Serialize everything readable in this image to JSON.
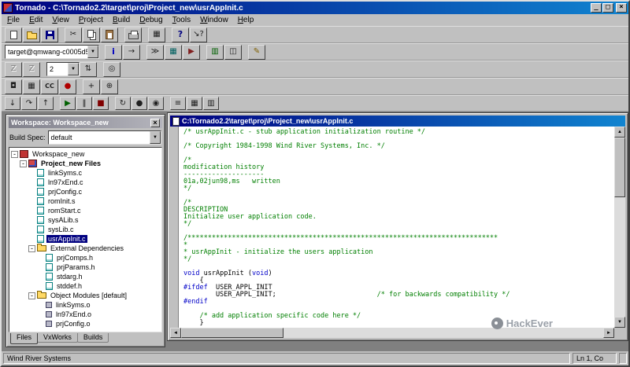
{
  "window": {
    "title": "Tornado - C:\\Tornado2.2\\target\\proj\\Project_new\\usrAppInit.c",
    "controls": {
      "minimize": "_",
      "maximize": "□",
      "close": "×"
    }
  },
  "menu": {
    "items": [
      "File",
      "Edit",
      "View",
      "Project",
      "Build",
      "Debug",
      "Tools",
      "Window",
      "Help"
    ]
  },
  "icons": {
    "chevron_down": "▼",
    "scroll_up": "▲",
    "scroll_down": "▼",
    "scroll_left": "◄",
    "scroll_right": "►",
    "collapse": "-"
  },
  "toolbars": [
    {
      "items": [
        {
          "name": "new-file-button",
          "icon": "new-document-icon",
          "shape": "s-doc"
        },
        {
          "name": "open-file-button",
          "icon": "open-folder-icon",
          "shape": "s-folder"
        },
        {
          "name": "save-button",
          "icon": "save-icon",
          "shape": "s-save"
        },
        {
          "type": "sep"
        },
        {
          "name": "cut-button",
          "icon": "scissors-icon",
          "glyph": "✂"
        },
        {
          "name": "copy-button",
          "icon": "copy-icon",
          "shape": "s-copy"
        },
        {
          "name": "paste-button",
          "icon": "paste-icon",
          "shape": "s-paste"
        },
        {
          "type": "sep"
        },
        {
          "name": "print-button",
          "icon": "printer-icon",
          "shape": "s-print"
        },
        {
          "type": "sep"
        },
        {
          "name": "workspace-toggle-button",
          "icon": "workspace-panel-icon",
          "glyph": "▦"
        },
        {
          "type": "sep"
        },
        {
          "name": "help-button",
          "icon": "help-icon",
          "glyph": "?",
          "color": "#000080"
        },
        {
          "name": "context-help-button",
          "icon": "context-help-icon",
          "glyph": "↘?"
        }
      ]
    },
    {
      "items": [
        {
          "type": "combo",
          "name": "target-selector",
          "value": "target@qmwang-c0005d5"
        },
        {
          "type": "sep"
        },
        {
          "name": "target-info-button",
          "icon": "info-icon",
          "glyph": "i",
          "color": "#0000c0"
        },
        {
          "name": "attach-target-button",
          "icon": "attach-target-icon",
          "glyph": "→"
        },
        {
          "type": "sep"
        },
        {
          "name": "launch-shell-button",
          "icon": "shell-icon",
          "glyph": "≫"
        },
        {
          "name": "browser-button",
          "icon": "browser-icon",
          "glyph": "▦",
          "color": "#006060"
        },
        {
          "name": "debugger-button",
          "icon": "debugger-icon",
          "glyph": "▶",
          "color": "#802020"
        },
        {
          "type": "sep"
        },
        {
          "name": "windview-button",
          "icon": "windview-icon",
          "glyph": "▥",
          "color": "#006000"
        },
        {
          "name": "registry-button",
          "icon": "registry-icon",
          "glyph": "◫"
        },
        {
          "type": "sep"
        },
        {
          "name": "editor-button",
          "icon": "pencil-icon",
          "glyph": "✎",
          "color": "#806000"
        }
      ]
    },
    {
      "items": [
        {
          "name": "undo-button",
          "icon": "undo-icon",
          "glyph": "Z",
          "disabled": true
        },
        {
          "name": "redo-button",
          "icon": "redo-icon",
          "glyph": "Z",
          "disabled": true
        },
        {
          "type": "sep"
        },
        {
          "type": "combo",
          "name": "history-selector",
          "value": "2"
        },
        {
          "name": "navigate-stack-button",
          "icon": "up-down-arrows-icon",
          "glyph": "⇅"
        },
        {
          "type": "sep"
        },
        {
          "name": "find-symbol-button",
          "icon": "search-icon",
          "glyph": "◎"
        }
      ]
    },
    {
      "items": [
        {
          "name": "target-lock-button",
          "icon": "lock-icon",
          "glyph": "◘"
        },
        {
          "name": "memory-view-button",
          "icon": "memory-grid-icon",
          "glyph": "▦"
        },
        {
          "name": "code-coverage-button",
          "icon": "code-coverage-icon",
          "glyph": "CC"
        },
        {
          "name": "record-button",
          "icon": "record-icon",
          "glyph": "●",
          "color": "#b00000"
        },
        {
          "type": "sep"
        },
        {
          "name": "add-watch-button",
          "icon": "plus-icon",
          "glyph": "+"
        },
        {
          "name": "configure-button",
          "icon": "configure-icon",
          "glyph": "⊕"
        }
      ]
    },
    {
      "items": [
        {
          "name": "step-into-button",
          "icon": "step-into-icon",
          "glyph": "↓"
        },
        {
          "name": "step-over-button",
          "icon": "step-over-icon",
          "glyph": "↷"
        },
        {
          "name": "step-out-button",
          "icon": "step-out-icon",
          "glyph": "↑"
        },
        {
          "type": "sep"
        },
        {
          "name": "run-button",
          "icon": "run-icon",
          "glyph": "▶",
          "color": "#006000"
        },
        {
          "name": "pause-button",
          "icon": "pause-icon",
          "glyph": "‖"
        },
        {
          "name": "stop-button",
          "icon": "stop-icon",
          "glyph": "■",
          "color": "#800000"
        },
        {
          "type": "sep"
        },
        {
          "name": "restart-button",
          "icon": "restart-icon",
          "glyph": "↻"
        },
        {
          "name": "breakpoint-button",
          "icon": "breakpoint-icon",
          "glyph": "●"
        },
        {
          "name": "watch-button",
          "icon": "watch-icon",
          "glyph": "◉"
        },
        {
          "type": "sep"
        },
        {
          "name": "stack-button",
          "icon": "stack-icon",
          "glyph": "≡"
        },
        {
          "name": "memory-button",
          "icon": "memory-icon",
          "glyph": "▦"
        },
        {
          "name": "registers-button",
          "icon": "registers-icon",
          "glyph": "▥"
        }
      ]
    }
  ],
  "workspace": {
    "title": "Workspace: Workspace_new",
    "close_label": "×",
    "build_spec_label": "Build Spec:",
    "build_spec_value": "default",
    "tabs": [
      "Files",
      "VxWorks",
      "Builds"
    ],
    "tree": [
      {
        "label": "Workspace_new",
        "level": 0,
        "icon": "workspace",
        "expander": "minus"
      },
      {
        "label": "Project_new Files",
        "level": 1,
        "icon": "project",
        "expander": "minus",
        "bold": true
      },
      {
        "label": "linkSyms.c",
        "level": 2,
        "icon": "source-file"
      },
      {
        "label": "ln97xEnd.c",
        "level": 2,
        "icon": "source-file"
      },
      {
        "label": "prjConfig.c",
        "level": 2,
        "icon": "source-file"
      },
      {
        "label": "romInit.s",
        "level": 2,
        "icon": "source-file"
      },
      {
        "label": "romStart.c",
        "level": 2,
        "icon": "source-file"
      },
      {
        "label": "sysALib.s",
        "level": 2,
        "icon": "source-file"
      },
      {
        "label": "sysLib.c",
        "level": 2,
        "icon": "source-file"
      },
      {
        "label": "usrAppInit.c",
        "level": 2,
        "icon": "source-file",
        "selected": true
      },
      {
        "label": "External Dependencies",
        "level": 2,
        "icon": "folder",
        "expander": "minus"
      },
      {
        "label": "prjComps.h",
        "level": 3,
        "icon": "header-file"
      },
      {
        "label": "prjParams.h",
        "level": 3,
        "icon": "header-file"
      },
      {
        "label": "stdarg.h",
        "level": 3,
        "icon": "header-file"
      },
      {
        "label": "stddef.h",
        "level": 3,
        "icon": "header-file"
      },
      {
        "label": "Object Modules [default]",
        "level": 2,
        "icon": "folder",
        "expander": "minus"
      },
      {
        "label": "linkSyms.o",
        "level": 3,
        "icon": "object-file"
      },
      {
        "label": "ln97xEnd.o",
        "level": 3,
        "icon": "object-file"
      },
      {
        "label": "prjConfig.o",
        "level": 3,
        "icon": "object-file"
      }
    ]
  },
  "editor": {
    "title": "C:\\Tornado2.2\\target\\proj\\Project_new\\usrAppInit.c",
    "code_lines": [
      [
        [
          "cm",
          "/* usrAppInit.c - stub application initialization routine */"
        ]
      ],
      [],
      [
        [
          "cm",
          "/* Copyright 1984-1998 Wind River Systems, Inc. */"
        ]
      ],
      [],
      [
        [
          "cm",
          "/*"
        ]
      ],
      [
        [
          "cm",
          "modification history"
        ]
      ],
      [
        [
          "cm",
          "--------------------"
        ]
      ],
      [
        [
          "cm",
          "01a,02jun98,ms   written"
        ]
      ],
      [
        [
          "cm",
          "*/"
        ]
      ],
      [],
      [
        [
          "cm",
          "/*"
        ]
      ],
      [
        [
          "cm",
          "DESCRIPTION"
        ]
      ],
      [
        [
          "cm",
          "Initialize user application code."
        ]
      ],
      [
        [
          "cm",
          "*/"
        ]
      ],
      [],
      [
        [
          "cm",
          "/*****************************************************************************"
        ]
      ],
      [
        [
          "cm",
          "*"
        ]
      ],
      [
        [
          "cm",
          "* usrAppInit - initialize the users application"
        ]
      ],
      [
        [
          "cm",
          "*/"
        ]
      ],
      [],
      [
        [
          "kw",
          "void"
        ],
        [
          "pl",
          " usrAppInit ("
        ],
        [
          "kw",
          "void"
        ],
        [
          "pl",
          ")"
        ]
      ],
      [
        [
          "pl",
          "    {"
        ]
      ],
      [
        [
          "kw",
          "#ifdef"
        ],
        [
          "pl",
          "  USER_APPL_INIT"
        ]
      ],
      [
        [
          "pl",
          "        USER_APPL_INIT;                         "
        ],
        [
          "cm",
          "/* for backwards compatibility */"
        ]
      ],
      [
        [
          "kw",
          "#endif"
        ]
      ],
      [],
      [
        [
          "cm",
          "    /* add application specific code here */"
        ]
      ],
      [
        [
          "pl",
          "    }"
        ]
      ]
    ]
  },
  "statusbar": {
    "message": "Wind River Systems",
    "position": "Ln 1, Co"
  },
  "watermark": {
    "text": "HackEver"
  }
}
